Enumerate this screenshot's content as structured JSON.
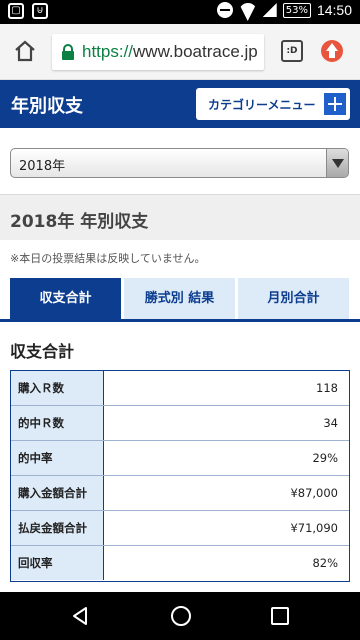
{
  "status_bar": {
    "time": "14:50",
    "battery": "53%"
  },
  "browser": {
    "url_scheme": "https://",
    "url_host": "www.boatrace.jp",
    "tab_badge": ":D"
  },
  "header": {
    "title": "年別収支",
    "category_button": "カテゴリーメニュー"
  },
  "year_select": {
    "selected": "2018年"
  },
  "section": {
    "title": "2018年 年別収支",
    "notice": "※本日の投票結果は反映していません。"
  },
  "tabs": [
    {
      "label": "収支合計",
      "active": true
    },
    {
      "label": "勝式別 結果",
      "active": false
    },
    {
      "label": "月別合計",
      "active": false
    }
  ],
  "summary": {
    "title": "収支合計",
    "rows": [
      {
        "label": "購入Ｒ数",
        "value": "118"
      },
      {
        "label": "的中Ｒ数",
        "value": "34"
      },
      {
        "label": "的中率",
        "value": "29%"
      },
      {
        "label": "購入金額合計",
        "value": "¥87,000"
      },
      {
        "label": "払戻金額合計",
        "value": "¥71,090"
      },
      {
        "label": "回収率",
        "value": "82%"
      }
    ]
  },
  "colors": {
    "brand_navy": "#0c3d8f",
    "tab_light": "#ddeaf8",
    "accent_blue": "#1e5fc9",
    "update_red": "#e8543e",
    "secure_green": "#0b8043"
  }
}
